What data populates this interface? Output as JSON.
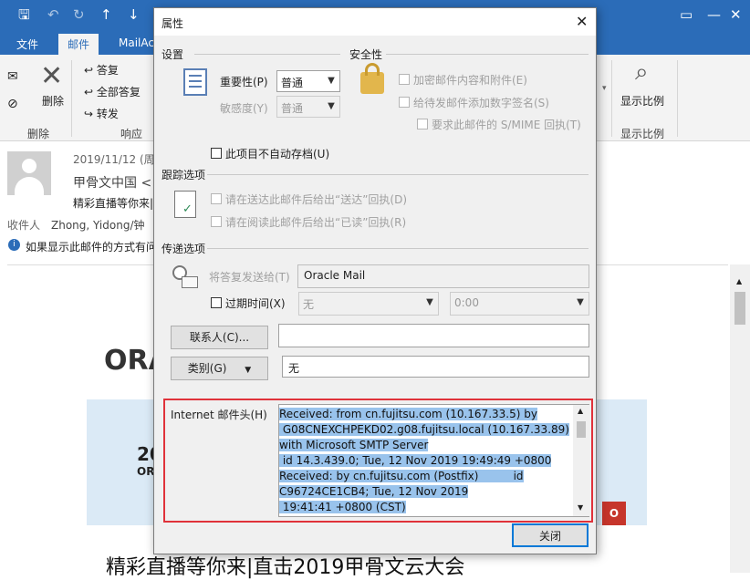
{
  "outlook": {
    "tabs": [
      "文件",
      "邮件",
      "MailAc"
    ],
    "ribbon": {
      "delete_label": "删除",
      "reply_label": "答复",
      "reply_all_label": "全部答复",
      "forward_label": "转发",
      "group_delete": "删除",
      "group_respond": "响应",
      "zoom_label": "显示比例",
      "group_zoom": "显示比例"
    },
    "message": {
      "date": "2019/11/12 (周",
      "sender": "甲骨文中国 <",
      "subject": "精彩直播等你来|",
      "recipients_label": "收件人",
      "recipients": "Zhong, Yidong/钟",
      "info_bar": "如果显示此邮件的方式有问",
      "body_logo": "ORA",
      "banner_text_1": "20",
      "banner_text_2": "OR",
      "bottom_text": "精彩直播等你来|直击2019甲骨文云大会"
    }
  },
  "dialog": {
    "title": "属性",
    "settings": {
      "heading": "设置",
      "importance_label": "重要性(P)",
      "importance_value": "普通",
      "sensitivity_label": "敏感度(Y)",
      "sensitivity_value": "普通",
      "no_autoarchive": "此项目不自动存档(U)"
    },
    "security": {
      "heading": "安全性",
      "encrypt": "加密邮件内容和附件(E)",
      "sign": "给待发邮件添加数字签名(S)",
      "smime": "要求此邮件的 S/MIME 回执(T)"
    },
    "tracking": {
      "heading": "跟踪选项",
      "delivery_receipt": "请在送达此邮件后给出“送达”回执(D)",
      "read_receipt": "请在阅读此邮件后给出“已读”回执(R)"
    },
    "delivery": {
      "heading": "传递选项",
      "reply_to_label": "将答复发送给(T)",
      "reply_to_value": "Oracle Mail",
      "expires_label": "过期时间(X)",
      "expires_date": "无",
      "expires_time": "0:00",
      "contacts_button": "联系人(C)...",
      "categories_button": "类别(G)",
      "categories_value": "无"
    },
    "internet_headers": {
      "label": "Internet 邮件头(H)",
      "lines": [
        "Received: from cn.fujitsu.com (10.167.33.5) by",
        " G08CNEXCHPEKD02.g08.fujitsu.local (10.167.33.89)",
        "with Microsoft SMTP Server",
        " id 14.3.439.0; Tue, 12 Nov 2019 19:49:49 +0800",
        "Received: by cn.fujitsu.com (Postfix)          id",
        "C96724CE1CB4; Tue, 12 Nov 2019",
        " 19:41:41 +0800 (CST)"
      ]
    },
    "close_button": "关闭"
  },
  "colors": {
    "accent": "#2b6cb8",
    "highlight": "#99c3ec",
    "red_frame": "#e0323a"
  }
}
